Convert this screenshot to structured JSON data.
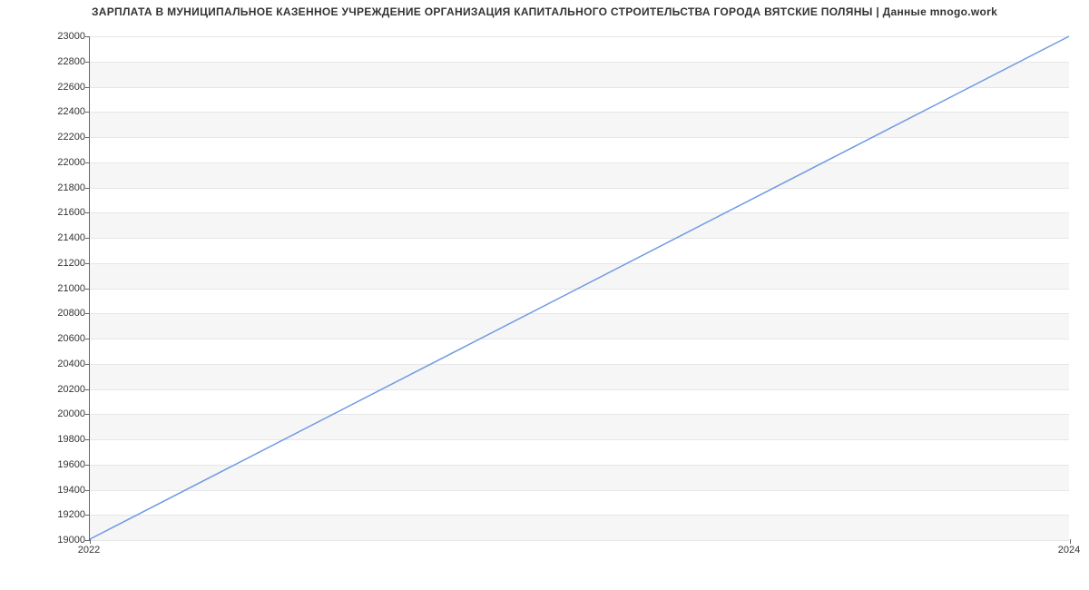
{
  "chart_data": {
    "type": "line",
    "title": "ЗАРПЛАТА В МУНИЦИПАЛЬНОЕ КАЗЕННОЕ УЧРЕЖДЕНИЕ ОРГАНИЗАЦИЯ КАПИТАЛЬНОГО СТРОИТЕЛЬСТВА ГОРОДА ВЯТСКИЕ ПОЛЯНЫ | Данные mnogo.work",
    "x": [
      2022,
      2024
    ],
    "y": [
      19000,
      23000
    ],
    "x_ticks": [
      "2022",
      "2024"
    ],
    "y_ticks": [
      19000,
      19200,
      19400,
      19600,
      19800,
      20000,
      20200,
      20400,
      20600,
      20800,
      21000,
      21200,
      21400,
      21600,
      21800,
      22000,
      22200,
      22400,
      22600,
      22800,
      23000
    ],
    "ylim": [
      19000,
      23000
    ],
    "xlim": [
      2022,
      2024
    ],
    "xlabel": "",
    "ylabel": "",
    "line_color": "#6f9ae3"
  }
}
